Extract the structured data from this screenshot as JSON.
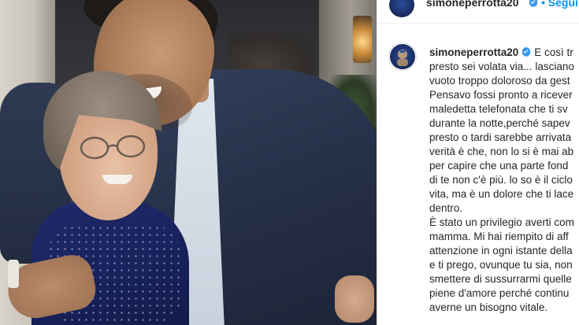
{
  "header": {
    "username": "simoneperrotta20",
    "follow_label": "• Segui"
  },
  "icons": {
    "verified": "verified-badge-icon",
    "avatar": "profile-avatar"
  },
  "colors": {
    "username_text": "#262626",
    "verified_blue": "#3897f0",
    "follow_blue": "#0095f6"
  },
  "caption": {
    "username": "simoneperrotta20",
    "lines": [
      "E così tr",
      "presto sei volata via... lasciano",
      "vuoto troppo doloroso da gest",
      "Pensavo fossi pronto a ricever",
      "maledetta telefonata che ti sv",
      "durante la notte,perché sapev",
      "presto o tardi sarebbe arrivata",
      "verità è che, non lo si è mai ab",
      "per capire che una parte fond",
      "di te non c'è più. lo so è il ciclo",
      "vita, ma è un dolore che ti lace",
      "dentro.",
      "È stato un privilegio averti com",
      "mamma. Mi hai riempito di aff",
      "attenzione in ogni istante della",
      "e ti prego, ovunque tu sia, non",
      "smettere di sussurrarmi quelle",
      "piene d'amore perché continu",
      "averne un bisogno vitale."
    ]
  }
}
